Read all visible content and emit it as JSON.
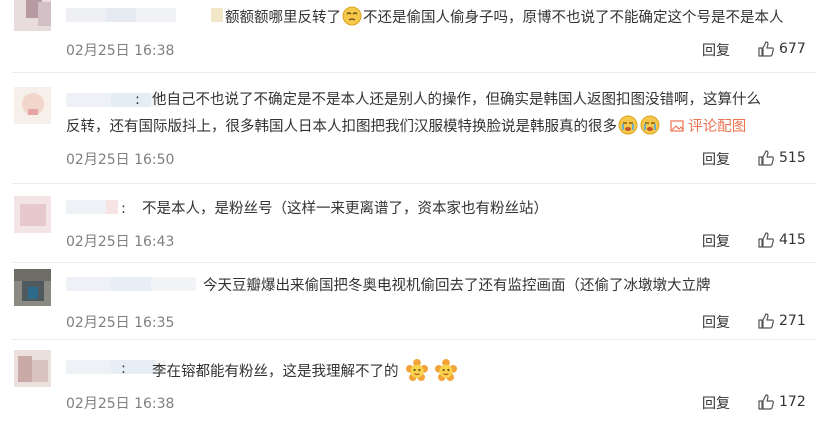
{
  "comments": [
    {
      "text_a": "额额额哪里反转了",
      "text_b": "不还是偷国人偷身子吗，原博不也说了不能确定这个号是不是本人",
      "time": "02月25日 16:38",
      "reply": "回复",
      "likes": "677",
      "emoji": "sad-face"
    },
    {
      "prefix": ":",
      "line1": "他自己不也说了不确定是不是本人还是别人的操作，但确实是韩国人返图扣图没错啊，这算什么",
      "line2": "反转，还有国际版抖上，很多韩国人日本人扣图把我们汉服模特换脸说是韩服真的很多",
      "link": "评论配图",
      "time": "02月25日 16:50",
      "reply": "回复",
      "likes": "515",
      "emoji": "crying-face"
    },
    {
      "prefix": ":",
      "text": "不是本人，是粉丝号（这样一来更离谱了，资本家也有粉丝站）",
      "time": "02月25日 16:43",
      "reply": "回复",
      "likes": "415"
    },
    {
      "text": "今天豆瓣爆出来偷国把冬奥电视机偷回去了还有监控画面（还偷了冰墩墩大立牌",
      "time": "02月25日 16:35",
      "reply": "回复",
      "likes": "271"
    },
    {
      "prefix": ":",
      "text": "李在镕都能有粉丝，这是我理解不了的",
      "time": "02月25日 16:38",
      "reply": "回复",
      "likes": "172",
      "emoji": "flower-face"
    }
  ],
  "colors": {
    "link": "#eb7350",
    "meta": "#808080",
    "text": "#333333"
  }
}
